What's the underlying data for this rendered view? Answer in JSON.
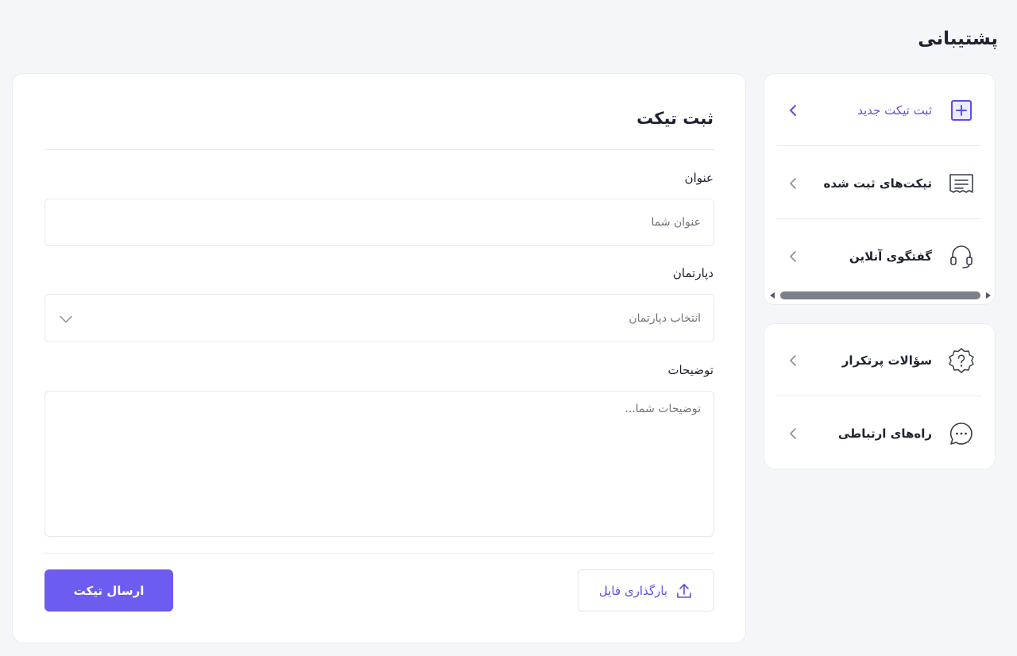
{
  "page": {
    "title": "پشتیبانی"
  },
  "sidebar": {
    "primary_items": [
      {
        "label": "ثبت تیکت جدید",
        "icon": "plus-square-icon",
        "active": true
      },
      {
        "label": "تیکت‌های ثبت شده",
        "icon": "receipt-list-icon",
        "active": false
      },
      {
        "label": "گفتگوی آنلاین",
        "icon": "headset-icon",
        "active": false
      }
    ],
    "secondary_items": [
      {
        "label": "سؤالات پرتکرار",
        "icon": "question-badge-icon"
      },
      {
        "label": "راه‌های ارتباطی",
        "icon": "chat-bubble-icon"
      }
    ]
  },
  "form": {
    "title": "ثبت تیکت",
    "subject_label": "عنوان",
    "subject_placeholder": "عنوان شما",
    "department_label": "دپارتمان",
    "department_placeholder": "انتخاب دپارتمان",
    "description_label": "توضیحات",
    "description_placeholder": "توضیحات شما...",
    "upload_label": "بارگذاری فایل",
    "submit_label": "ارسال تیکت"
  },
  "colors": {
    "accent": "#6c5cf0",
    "accent_text": "#5b4fe6",
    "background": "#f4f6f9"
  }
}
